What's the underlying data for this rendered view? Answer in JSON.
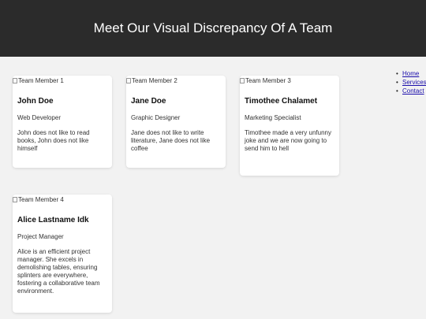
{
  "header": {
    "title": "Meet Our Visual Discrepancy Of A Team"
  },
  "nav": {
    "items": [
      {
        "label": "Home"
      },
      {
        "label": "Services"
      },
      {
        "label": "Contact"
      }
    ]
  },
  "team": [
    {
      "img_alt": "Team Member 1",
      "name": "John Doe",
      "role": "Web Developer",
      "desc": "John does not like to read books, John does not like himself"
    },
    {
      "img_alt": "Team Member 2",
      "name": "Jane Doe",
      "role": "Graphic Designer",
      "desc": "Jane does not like to write literature, Jane does not like coffee"
    },
    {
      "img_alt": "Team Member 3",
      "name": "Timothee Chalamet",
      "role": "Marketing Specialist",
      "desc": "Timothee made a very unfunny joke and we are now going to send him to hell"
    },
    {
      "img_alt": "Team Member 4",
      "name": "Alice Lastname Idk",
      "role": "Project Manager",
      "desc": "Alice is an efficient project manager. She excels in demolishing tables, ensuring splinters are everywhere, fostering a collaborative team environment."
    }
  ]
}
